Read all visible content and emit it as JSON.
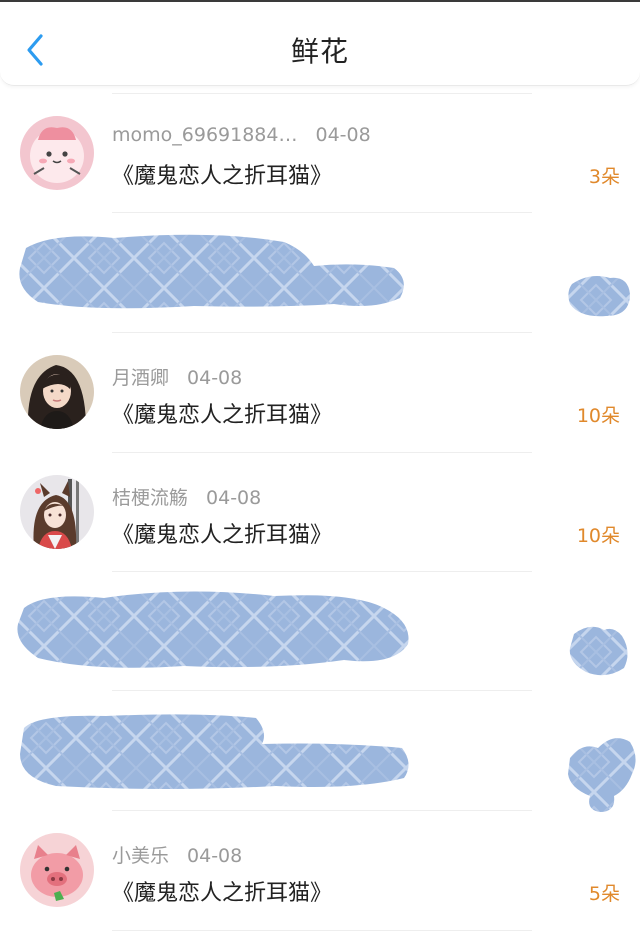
{
  "header": {
    "title": "鲜花",
    "back_icon": "chevron-left-icon"
  },
  "colors": {
    "accent": "#2d9cf0",
    "count": "#e0892c",
    "redaction": "#9bb6dd"
  },
  "rows": [
    {
      "name": "momo_69691884…",
      "date": "04-08",
      "book": "《魔鬼恋人之折耳猫》",
      "count": "3朵",
      "avatar": "pink-blob-avatar"
    },
    {
      "redacted": true
    },
    {
      "name": "月酒卿",
      "date": "04-08",
      "book": "《魔鬼恋人之折耳猫》",
      "count": "10朵",
      "avatar": "photo-avatar"
    },
    {
      "name": "桔梗流觞",
      "date": "04-08",
      "book": "《魔鬼恋人之折耳猫》",
      "count": "10朵",
      "avatar": "anime-avatar"
    },
    {
      "redacted": true
    },
    {
      "redacted": true
    },
    {
      "name": "小美乐",
      "date": "04-08",
      "book": "《魔鬼恋人之折耳猫》",
      "count": "5朵",
      "avatar": "pig-avatar"
    }
  ]
}
